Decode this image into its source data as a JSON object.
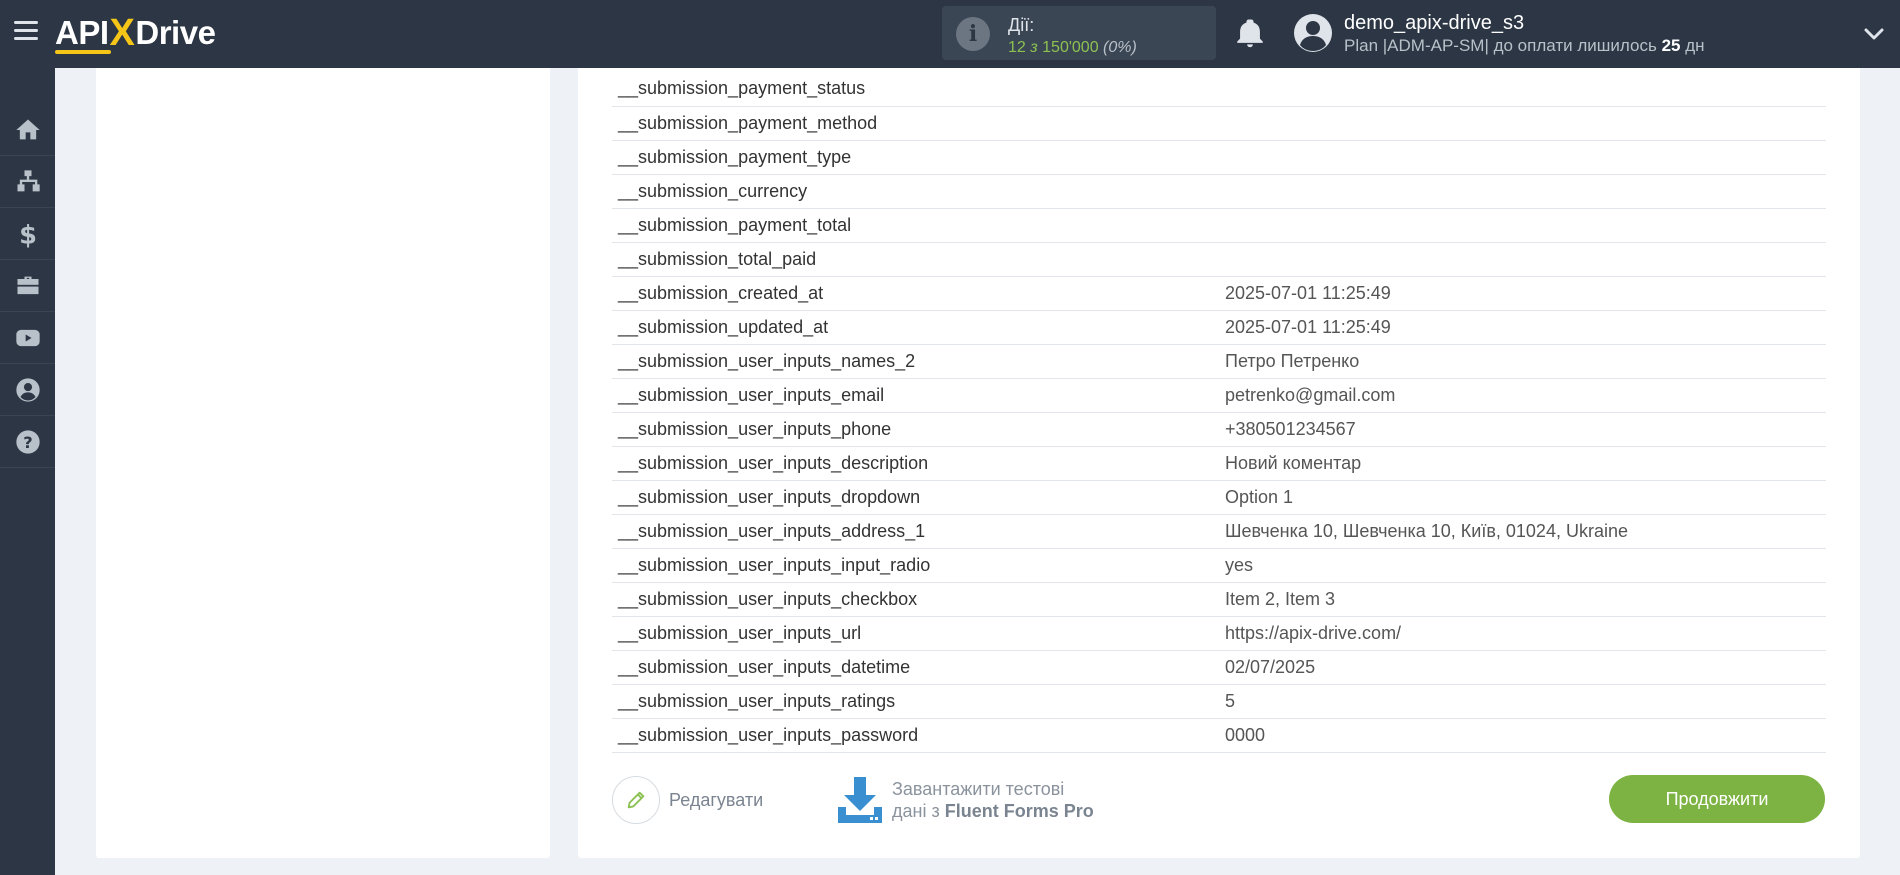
{
  "header": {
    "logo": {
      "api": "API",
      "x": "X",
      "drive": "Drive"
    },
    "actions": {
      "label": "Дії:",
      "count": "12",
      "of": "з",
      "total": "150'000",
      "percent": "(0%)"
    },
    "user": {
      "name": "demo_apix-drive_s3",
      "plan_prefix": "Plan |ADM-AP-SM| до оплати лишилось",
      "days": "25",
      "days_unit": "дн"
    }
  },
  "sidebar": {
    "items": [
      {
        "icon": "home-icon"
      },
      {
        "icon": "sitemap-icon"
      },
      {
        "icon": "dollar-icon"
      },
      {
        "icon": "briefcase-icon"
      },
      {
        "icon": "youtube-icon"
      },
      {
        "icon": "user-circle-icon"
      },
      {
        "icon": "question-circle-icon"
      }
    ]
  },
  "fields": [
    {
      "key": "__submission_payment_status",
      "value": ""
    },
    {
      "key": "__submission_payment_method",
      "value": ""
    },
    {
      "key": "__submission_payment_type",
      "value": ""
    },
    {
      "key": "__submission_currency",
      "value": ""
    },
    {
      "key": "__submission_payment_total",
      "value": ""
    },
    {
      "key": "__submission_total_paid",
      "value": ""
    },
    {
      "key": "__submission_created_at",
      "value": "2025-07-01 11:25:49"
    },
    {
      "key": "__submission_updated_at",
      "value": "2025-07-01 11:25:49"
    },
    {
      "key": "__submission_user_inputs_names_2",
      "value": "Петро Петренко"
    },
    {
      "key": "__submission_user_inputs_email",
      "value": "petrenko@gmail.com"
    },
    {
      "key": "__submission_user_inputs_phone",
      "value": "+380501234567"
    },
    {
      "key": "__submission_user_inputs_description",
      "value": "Новий коментар"
    },
    {
      "key": "__submission_user_inputs_dropdown",
      "value": "Option 1"
    },
    {
      "key": "__submission_user_inputs_address_1",
      "value": "Шевченка 10, Шевченка 10, Київ, 01024, Ukraine"
    },
    {
      "key": "__submission_user_inputs_input_radio",
      "value": "yes"
    },
    {
      "key": "__submission_user_inputs_checkbox",
      "value": "Item 2, Item 3"
    },
    {
      "key": "__submission_user_inputs_url",
      "value": "https://apix-drive.com/"
    },
    {
      "key": "__submission_user_inputs_datetime",
      "value": "02/07/2025"
    },
    {
      "key": "__submission_user_inputs_ratings",
      "value": "5"
    },
    {
      "key": "__submission_user_inputs_password",
      "value": "0000"
    }
  ],
  "footer": {
    "edit_label": "Редагувати",
    "load_line1": "Завантажити тестові",
    "load_line2_prefix": "дані з",
    "load_service": "Fluent Forms Pro",
    "continue_label": "Продовжити"
  },
  "colors": {
    "topbar": "#2c3644",
    "accent_green": "#7cb342",
    "logo_yellow": "#f5c518",
    "download_blue": "#3a8fd0"
  }
}
